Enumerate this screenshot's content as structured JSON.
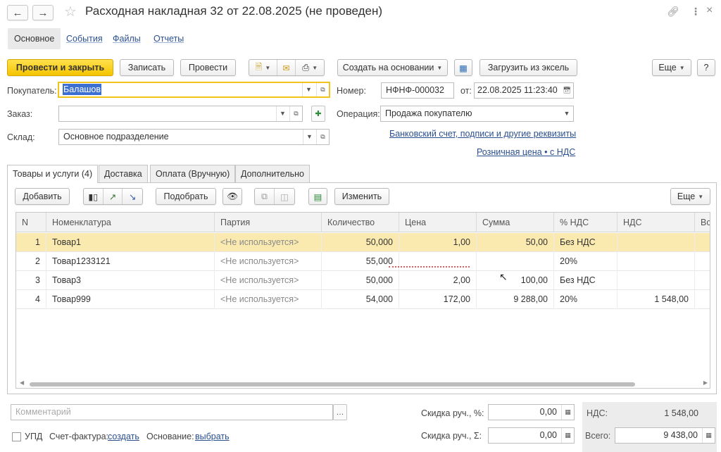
{
  "header": {
    "title": "Расходная накладная 32 от 22.08.2025 (не проведен)"
  },
  "section_tabs": [
    "Основное",
    "События",
    "Файлы",
    "Отчеты"
  ],
  "toolbar": {
    "post_close": "Провести и закрыть",
    "save": "Записать",
    "post": "Провести",
    "create_based": "Создать на основании",
    "load_excel": "Загрузить из эксель",
    "more": "Еще",
    "help": "?"
  },
  "form": {
    "buyer_label": "Покупатель:",
    "buyer_value": "Балашов",
    "order_label": "Заказ:",
    "order_value": "",
    "warehouse_label": "Склад:",
    "warehouse_value": "Основное подразделение",
    "number_label": "Номер:",
    "number_value": "НФНФ-000032",
    "date_label": "от:",
    "date_value": "22.08.2025 11:23:40",
    "operation_label": "Операция:",
    "operation_value": "Продажа покупателю",
    "bank_link": "Банковский счет, подписи и другие реквизиты",
    "price_link": "Розничная цена • с НДС"
  },
  "page_tabs": [
    "Товары и услуги (4)",
    "Доставка",
    "Оплата (Вручную)",
    "Дополнительно"
  ],
  "table_toolbar": {
    "add": "Добавить",
    "pick": "Подобрать",
    "change": "Изменить",
    "more": "Еще"
  },
  "table": {
    "columns": [
      "N",
      "Номенклатура",
      "Партия",
      "Количество",
      "Цена",
      "Сумма",
      "% НДС",
      "НДС",
      "Вс"
    ],
    "rows": [
      {
        "n": "1",
        "item": "Товар1",
        "batch": "<Не используется>",
        "qty": "50,000",
        "price": "1,00",
        "sum": "50,00",
        "vat_rate": "Без НДС",
        "vat": ""
      },
      {
        "n": "2",
        "item": "Товар1233121",
        "batch": "<Не используется>",
        "qty": "55,000",
        "price": "",
        "sum": "",
        "vat_rate": "20%",
        "vat": ""
      },
      {
        "n": "3",
        "item": "Товар3",
        "batch": "<Не используется>",
        "qty": "50,000",
        "price": "2,00",
        "sum": "100,00",
        "vat_rate": "Без НДС",
        "vat": ""
      },
      {
        "n": "4",
        "item": "Товар999",
        "batch": "<Не используется>",
        "qty": "54,000",
        "price": "172,00",
        "sum": "9 288,00",
        "vat_rate": "20%",
        "vat": "1 548,00"
      }
    ]
  },
  "footer": {
    "comment_placeholder": "Комментарий",
    "discount_pct_label": "Скидка руч., %:",
    "discount_pct_value": "0,00",
    "discount_sum_label": "Скидка руч., Σ:",
    "discount_sum_value": "0,00",
    "vat_label": "НДС:",
    "vat_value": "1 548,00",
    "total_label": "Всего:",
    "total_value": "9 438,00",
    "upd_label": "УПД",
    "invoice_label": "Счет-фактура:",
    "invoice_link": "создать",
    "basis_label": "Основание:",
    "basis_link": "выбрать"
  }
}
